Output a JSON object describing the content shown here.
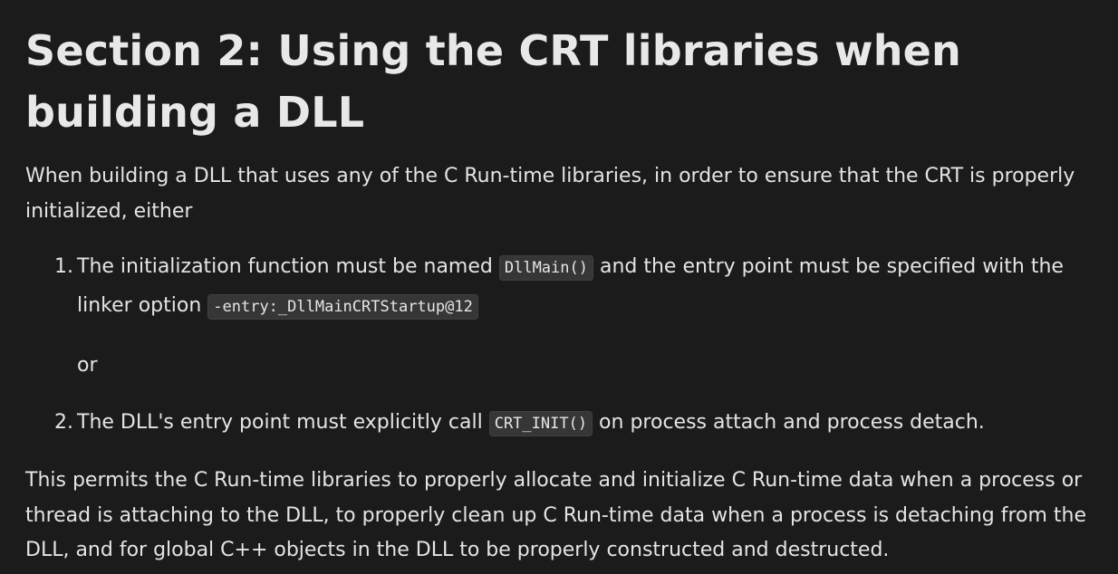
{
  "heading": "Section 2: Using the CRT libraries when building a DLL",
  "intro": "When building a DLL that uses any of the C Run-time libraries, in order to ensure that the CRT is properly initialized, either",
  "list": [
    {
      "number": "1.",
      "text_before": "The initialization function must be named ",
      "code_1": "DllMain()",
      "text_middle": " and the entry point must be specified with the linker option ",
      "code_2": "-entry:_DllMainCRTStartup@12",
      "or_text": "or"
    },
    {
      "number": "2.",
      "text_before": "The DLL's entry point must explicitly call ",
      "code_1": "CRT_INIT()",
      "text_after": " on process attach and process detach."
    }
  ],
  "closing": "This permits the C Run-time libraries to properly allocate and initialize C Run-time data when a process or thread is attaching to the DLL, to properly clean up C Run-time data when a process is detaching from the DLL, and for global C++ objects in the DLL to be properly constructed and destructed."
}
